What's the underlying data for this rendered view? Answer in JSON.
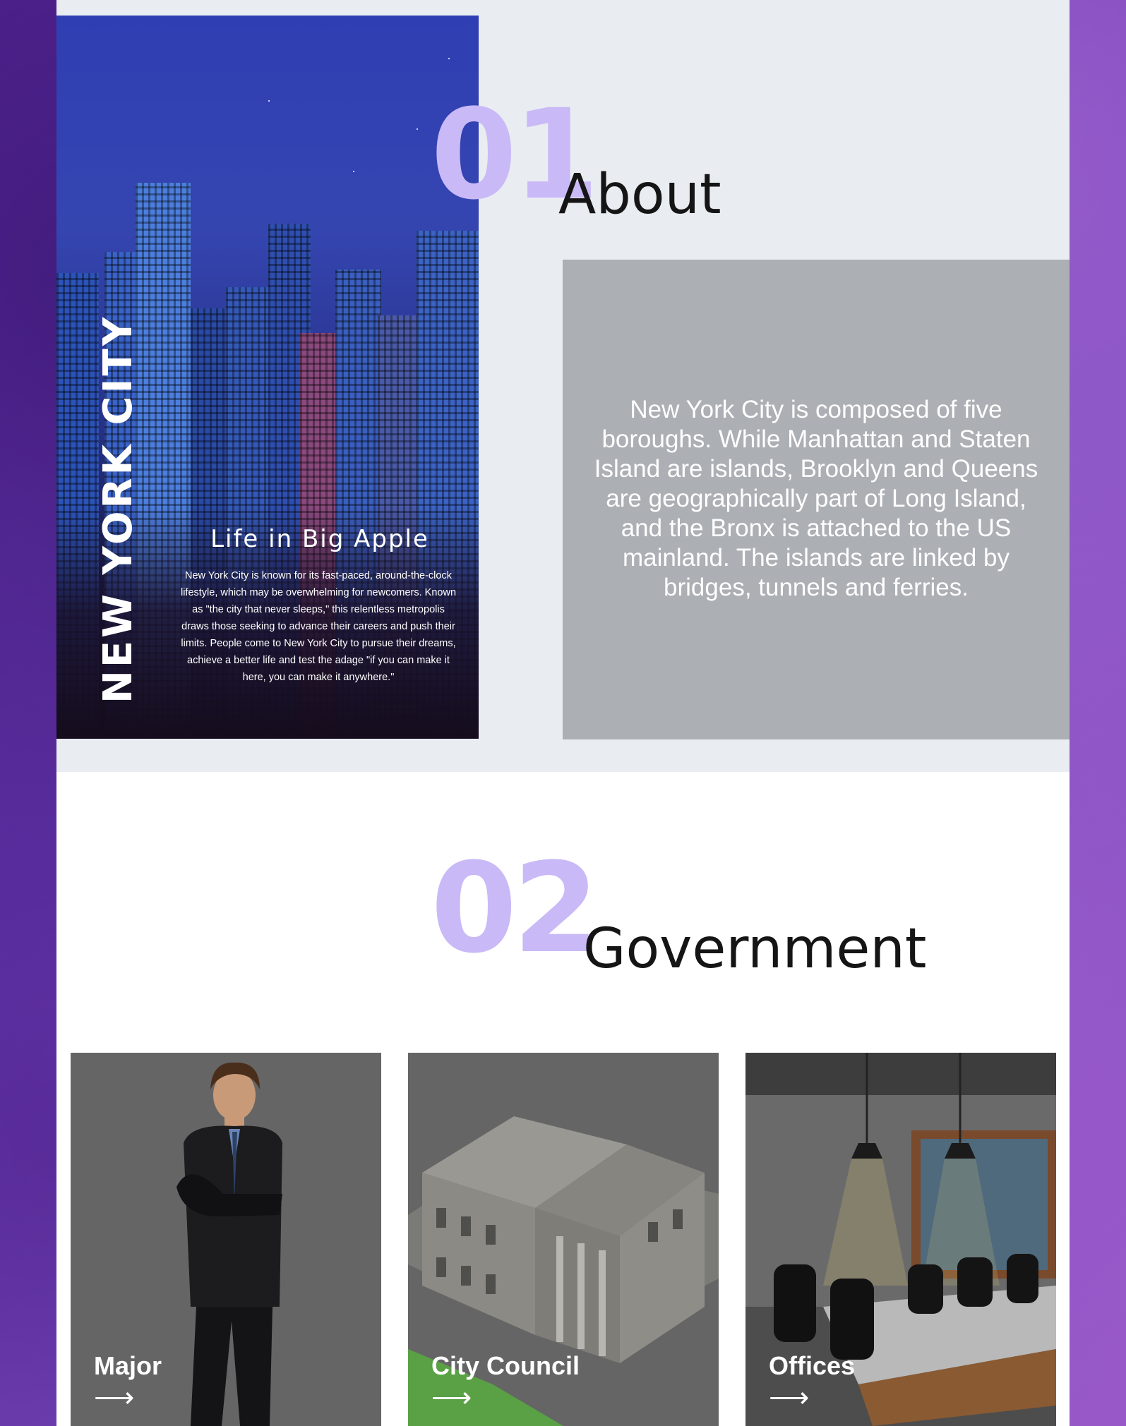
{
  "about": {
    "number": "01",
    "heading": "About",
    "vertical_title": "NEW YORK CITY",
    "hero_subtitle": "Life in Big Apple",
    "hero_body": "New York City is known for its fast-paced, around-the-clock lifestyle, which may be overwhelming for newcomers. Known as \"the city that never sleeps,\" this relentless metropolis draws those seeking to advance their careers and push their limits. People come to New York City to pursue their dreams, achieve a better life and test the adage \"if you can make it here, you can make it anywhere.\"",
    "description": "New York City is composed of five boroughs. While Manhattan and Staten Island are islands, Brooklyn and Queens are geographically part of Long Island, and the Bronx is attached to the US mainland. The islands are linked by bridges, tunnels and ferries."
  },
  "government": {
    "number": "02",
    "heading": "Government",
    "cards": [
      {
        "label": "Major",
        "icon": "arrow-right-icon"
      },
      {
        "label": "City Council",
        "icon": "arrow-right-icon"
      },
      {
        "label": "Offices",
        "icon": "arrow-right-icon"
      }
    ]
  },
  "colors": {
    "accent_number": "#c9b9f7",
    "about_box": "#acafb4",
    "section_bg": "#e9ecf1",
    "card_overlay": "#656565"
  }
}
